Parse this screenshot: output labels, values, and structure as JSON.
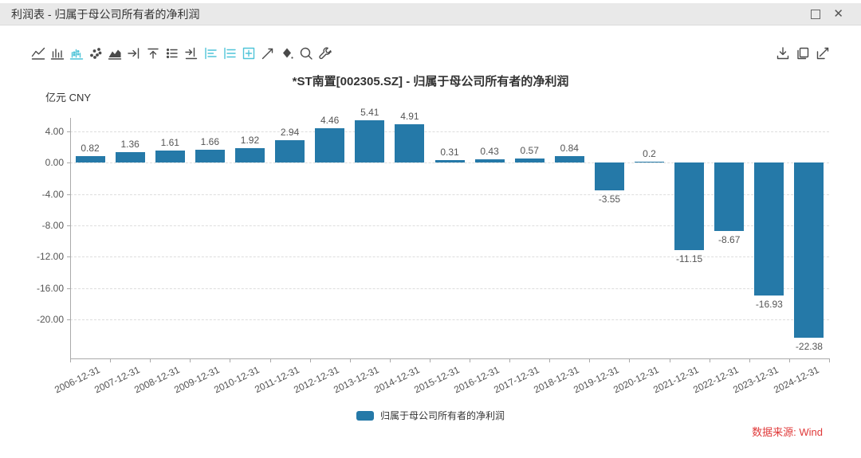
{
  "window": {
    "title": "利润表 - 归属于母公司所有者的净利润",
    "controls": [
      {
        "name": "maximize"
      },
      {
        "name": "close",
        "glyph": "✕"
      }
    ]
  },
  "toolbar": {
    "left_icons": [
      {
        "name": "line-chart",
        "active": false
      },
      {
        "name": "column-chart",
        "active": false
      },
      {
        "name": "column-chart-alt",
        "active": true
      },
      {
        "name": "scatter-chart",
        "active": false
      },
      {
        "name": "area-chart",
        "active": false
      },
      {
        "name": "shift-right",
        "active": false
      },
      {
        "name": "shift-up",
        "active": false
      },
      {
        "name": "data-list",
        "active": false
      },
      {
        "name": "export-right",
        "active": false
      },
      {
        "name": "align-left",
        "active": true
      },
      {
        "name": "align-justify",
        "active": true
      },
      {
        "name": "add-box",
        "active": true
      },
      {
        "name": "trend-line",
        "active": false
      },
      {
        "name": "fill-color",
        "active": false
      },
      {
        "name": "zoom-search",
        "active": false
      },
      {
        "name": "settings-wrench",
        "active": false
      }
    ],
    "right_icons": [
      {
        "name": "download",
        "active": false
      },
      {
        "name": "copy",
        "active": false
      },
      {
        "name": "edit-chart",
        "active": false
      }
    ]
  },
  "chart_data": {
    "type": "bar",
    "title": "*ST南置[002305.SZ] - 归属于母公司所有者的净利润",
    "unit_label": "亿元 CNY",
    "categories": [
      "2006-12-31",
      "2007-12-31",
      "2008-12-31",
      "2009-12-31",
      "2010-12-31",
      "2011-12-31",
      "2012-12-31",
      "2013-12-31",
      "2014-12-31",
      "2015-12-31",
      "2016-12-31",
      "2017-12-31",
      "2018-12-31",
      "2019-12-31",
      "2020-12-31",
      "2021-12-31",
      "2022-12-31",
      "2023-12-31",
      "2024-12-31"
    ],
    "values": [
      0.82,
      1.36,
      1.61,
      1.66,
      1.92,
      2.94,
      4.46,
      5.41,
      4.91,
      0.31,
      0.43,
      0.57,
      0.84,
      -3.55,
      0.2,
      -11.15,
      -8.67,
      -16.93,
      -22.38
    ],
    "value_labels": [
      "0.82",
      "1.36",
      "1.61",
      "1.66",
      "1.92",
      "2.94",
      "4.46",
      "5.41",
      "4.91",
      "0.31",
      "0.43",
      "0.57",
      "0.84",
      "-3.55",
      "0.2",
      "-11.15",
      "-8.67",
      "-16.93",
      "-22.38"
    ],
    "y_ticks": [
      4,
      0,
      -4,
      -8,
      -12,
      -16,
      -20
    ],
    "y_tick_labels": [
      "4.00",
      "0.00",
      "-4.00",
      "-8.00",
      "-12.00",
      "-16.00",
      "-20.00"
    ],
    "ylim": [
      -25,
      5.75
    ],
    "grid": true,
    "bar_color": "#2579a8",
    "legend_position": "bottom",
    "legend": [
      {
        "label": "归属于母公司所有者的净利润",
        "color": "#2579a8"
      }
    ]
  },
  "colors": {
    "toolbar_accent": "#4fc4d8",
    "bar": "#2579a8",
    "source_red": "#e03a3a"
  },
  "footer": {
    "source_label": "数据来源: Wind"
  }
}
